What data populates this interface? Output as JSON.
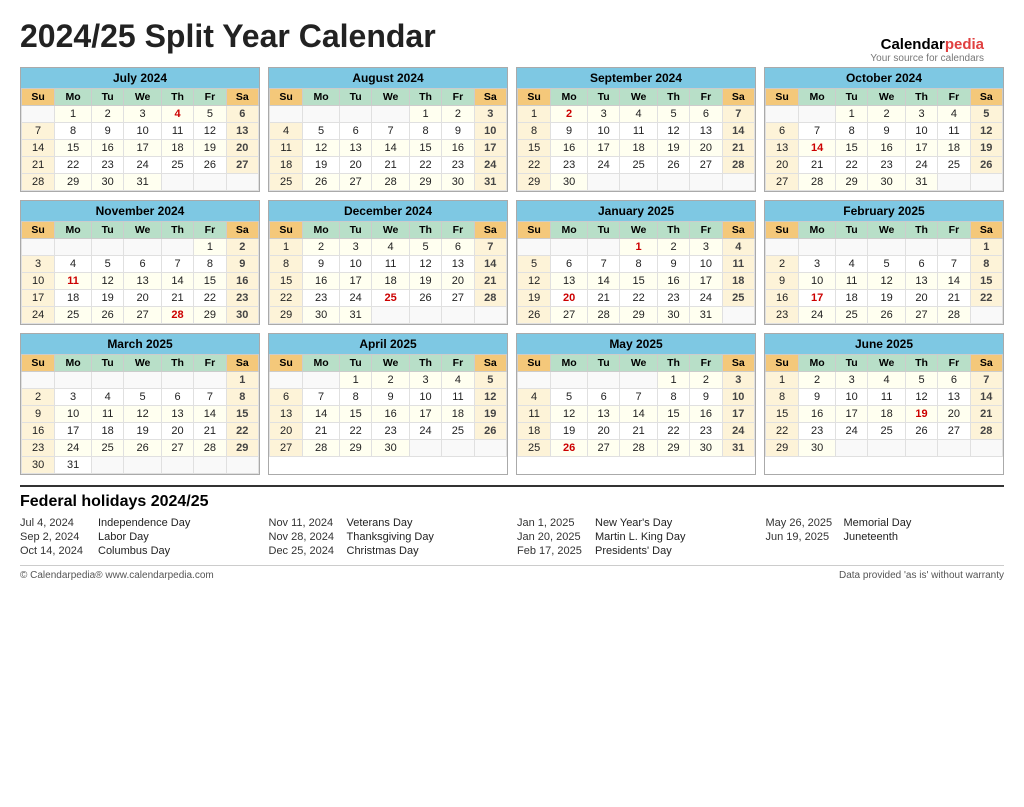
{
  "title": "2024/25 Split Year Calendar",
  "logo": {
    "part1": "Calendar",
    "part2": "pedia",
    "tagline": "Your source for calendars"
  },
  "months": [
    {
      "name": "July 2024",
      "start_dow": 1,
      "days": 31,
      "holidays": [
        4
      ],
      "holidays_sat": [],
      "weeks": [
        [
          "",
          "1",
          "2",
          "3",
          "4",
          "5",
          "6"
        ],
        [
          "7",
          "8",
          "9",
          "10",
          "11",
          "12",
          "13"
        ],
        [
          "14",
          "15",
          "16",
          "17",
          "18",
          "19",
          "20"
        ],
        [
          "21",
          "22",
          "23",
          "24",
          "25",
          "26",
          "27"
        ],
        [
          "28",
          "29",
          "30",
          "31",
          "",
          "",
          ""
        ]
      ]
    },
    {
      "name": "August 2024",
      "weeks": [
        [
          "",
          "",
          "",
          "",
          "1",
          "2",
          "3"
        ],
        [
          "4",
          "5",
          "6",
          "7",
          "8",
          "9",
          "10"
        ],
        [
          "11",
          "12",
          "13",
          "14",
          "15",
          "16",
          "17"
        ],
        [
          "18",
          "19",
          "20",
          "21",
          "22",
          "23",
          "24"
        ],
        [
          "25",
          "26",
          "27",
          "28",
          "29",
          "30",
          "31"
        ]
      ]
    },
    {
      "name": "September 2024",
      "weeks": [
        [
          "1",
          "2",
          "3",
          "4",
          "5",
          "6",
          "7"
        ],
        [
          "8",
          "9",
          "10",
          "11",
          "12",
          "13",
          "14"
        ],
        [
          "15",
          "16",
          "17",
          "18",
          "19",
          "20",
          "21"
        ],
        [
          "22",
          "23",
          "24",
          "25",
          "26",
          "27",
          "28"
        ],
        [
          "29",
          "30",
          "",
          "",
          "",
          "",
          ""
        ]
      ],
      "holidays": [
        2
      ]
    },
    {
      "name": "October 2024",
      "weeks": [
        [
          "",
          "",
          "1",
          "2",
          "3",
          "4",
          "5"
        ],
        [
          "6",
          "7",
          "8",
          "9",
          "10",
          "11",
          "12"
        ],
        [
          "13",
          "14",
          "15",
          "16",
          "17",
          "18",
          "19"
        ],
        [
          "20",
          "21",
          "22",
          "23",
          "24",
          "25",
          "26"
        ],
        [
          "27",
          "28",
          "29",
          "30",
          "31",
          "",
          ""
        ]
      ],
      "holidays": [
        14
      ]
    },
    {
      "name": "November 2024",
      "weeks": [
        [
          "",
          "",
          "",
          "",
          "",
          "1",
          "2"
        ],
        [
          "3",
          "4",
          "5",
          "6",
          "7",
          "8",
          "9"
        ],
        [
          "10",
          "11",
          "12",
          "13",
          "14",
          "15",
          "16"
        ],
        [
          "17",
          "18",
          "19",
          "20",
          "21",
          "22",
          "23"
        ],
        [
          "24",
          "25",
          "26",
          "27",
          "28",
          "29",
          "30"
        ]
      ],
      "holidays": [
        11,
        28
      ]
    },
    {
      "name": "December 2024",
      "weeks": [
        [
          "1",
          "2",
          "3",
          "4",
          "5",
          "6",
          "7"
        ],
        [
          "8",
          "9",
          "10",
          "11",
          "12",
          "13",
          "14"
        ],
        [
          "15",
          "16",
          "17",
          "18",
          "19",
          "20",
          "21"
        ],
        [
          "22",
          "23",
          "24",
          "25",
          "26",
          "27",
          "28"
        ],
        [
          "29",
          "30",
          "31",
          "",
          "",
          "",
          ""
        ]
      ],
      "holidays": [
        25
      ]
    },
    {
      "name": "January 2025",
      "weeks": [
        [
          "",
          "",
          "",
          "1",
          "2",
          "3",
          "4"
        ],
        [
          "5",
          "6",
          "7",
          "8",
          "9",
          "10",
          "11"
        ],
        [
          "12",
          "13",
          "14",
          "15",
          "16",
          "17",
          "18"
        ],
        [
          "19",
          "20",
          "21",
          "22",
          "23",
          "24",
          "25"
        ],
        [
          "26",
          "27",
          "28",
          "29",
          "30",
          "31",
          ""
        ]
      ],
      "holidays": [
        1,
        20
      ]
    },
    {
      "name": "February 2025",
      "weeks": [
        [
          "",
          "",
          "",
          "",
          "",
          "",
          "1"
        ],
        [
          "2",
          "3",
          "4",
          "5",
          "6",
          "7",
          "8"
        ],
        [
          "9",
          "10",
          "11",
          "12",
          "13",
          "14",
          "15"
        ],
        [
          "16",
          "17",
          "18",
          "19",
          "20",
          "21",
          "22"
        ],
        [
          "23",
          "24",
          "25",
          "26",
          "27",
          "28",
          ""
        ]
      ],
      "holidays": [
        17
      ]
    },
    {
      "name": "March 2025",
      "weeks": [
        [
          "",
          "",
          "",
          "",
          "",
          "",
          "1"
        ],
        [
          "2",
          "3",
          "4",
          "5",
          "6",
          "7",
          "8"
        ],
        [
          "9",
          "10",
          "11",
          "12",
          "13",
          "14",
          "15"
        ],
        [
          "16",
          "17",
          "18",
          "19",
          "20",
          "21",
          "22"
        ],
        [
          "23",
          "24",
          "25",
          "26",
          "27",
          "28",
          "29"
        ],
        [
          "30",
          "31",
          "",
          "",
          "",
          "",
          ""
        ]
      ]
    },
    {
      "name": "April 2025",
      "weeks": [
        [
          "",
          "",
          "1",
          "2",
          "3",
          "4",
          "5"
        ],
        [
          "6",
          "7",
          "8",
          "9",
          "10",
          "11",
          "12"
        ],
        [
          "13",
          "14",
          "15",
          "16",
          "17",
          "18",
          "19"
        ],
        [
          "20",
          "21",
          "22",
          "23",
          "24",
          "25",
          "26"
        ],
        [
          "27",
          "28",
          "29",
          "30",
          "",
          "",
          ""
        ]
      ]
    },
    {
      "name": "May 2025",
      "weeks": [
        [
          "",
          "",
          "",
          "",
          "1",
          "2",
          "3"
        ],
        [
          "4",
          "5",
          "6",
          "7",
          "8",
          "9",
          "10"
        ],
        [
          "11",
          "12",
          "13",
          "14",
          "15",
          "16",
          "17"
        ],
        [
          "18",
          "19",
          "20",
          "21",
          "22",
          "23",
          "24"
        ],
        [
          "25",
          "26",
          "27",
          "28",
          "29",
          "30",
          "31"
        ]
      ],
      "holidays": [
        26
      ]
    },
    {
      "name": "June 2025",
      "weeks": [
        [
          "1",
          "2",
          "3",
          "4",
          "5",
          "6",
          "7"
        ],
        [
          "8",
          "9",
          "10",
          "11",
          "12",
          "13",
          "14"
        ],
        [
          "15",
          "16",
          "17",
          "18",
          "19",
          "20",
          "21"
        ],
        [
          "22",
          "23",
          "24",
          "25",
          "26",
          "27",
          "28"
        ],
        [
          "29",
          "30",
          "",
          "",
          "",
          "",
          ""
        ]
      ],
      "holidays": [
        19
      ]
    }
  ],
  "holidays_section": {
    "title": "Federal holidays 2024/25",
    "columns": [
      [
        {
          "date": "Jul 4, 2024",
          "name": "Independence Day"
        },
        {
          "date": "Sep 2, 2024",
          "name": "Labor Day"
        },
        {
          "date": "Oct 14, 2024",
          "name": "Columbus Day"
        }
      ],
      [
        {
          "date": "Nov 11, 2024",
          "name": "Veterans Day"
        },
        {
          "date": "Nov 28, 2024",
          "name": "Thanksgiving Day"
        },
        {
          "date": "Dec 25, 2024",
          "name": "Christmas Day"
        }
      ],
      [
        {
          "date": "Jan 1, 2025",
          "name": "New Year's Day"
        },
        {
          "date": "Jan 20, 2025",
          "name": "Martin L. King Day"
        },
        {
          "date": "Feb 17, 2025",
          "name": "Presidents' Day"
        }
      ],
      [
        {
          "date": "May 26, 2025",
          "name": "Memorial Day"
        },
        {
          "date": "Jun 19, 2025",
          "name": "Juneteenth"
        }
      ]
    ]
  },
  "footer": {
    "left": "© Calendarpedia®   www.calendarpedia.com",
    "right": "Data provided 'as is' without warranty"
  },
  "day_headers": [
    "Su",
    "Mo",
    "Tu",
    "We",
    "Th",
    "Fr",
    "Sa"
  ]
}
